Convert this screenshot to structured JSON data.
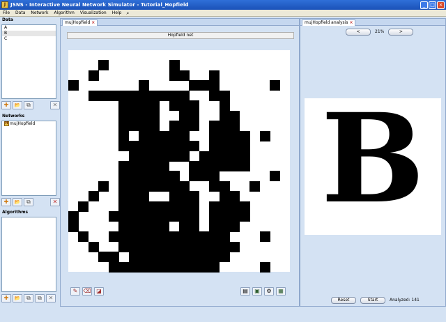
{
  "window": {
    "title": "JSNS - Interactive Neural Network Simulator - Tutorial_Hopfield",
    "icon_text": "J"
  },
  "menu": {
    "items": [
      "File",
      "Data",
      "Network",
      "Algorithm",
      "Visualization",
      "Help"
    ]
  },
  "data_section": {
    "header": "Data",
    "items": [
      "A",
      "B",
      "C"
    ],
    "selected_index": 1
  },
  "networks_section": {
    "header": "Networks",
    "items": [
      "mujHopfield"
    ],
    "badge": "H"
  },
  "algorithms_section": {
    "header": "Algorithms",
    "items": []
  },
  "net_panel": {
    "tab_label": "mujHopfield",
    "canvas_title": "Hopfield net",
    "grid_cols": 22,
    "grid_rows": 22,
    "pattern": [
      "......................",
      "...X......X...........",
      "..X.......XX..X.......",
      "X......X....XXX.....X.",
      "..XXXXXXXXXX..XX......",
      ".....XXXX.XXX..X......",
      ".....XXXX..XX..XX.....",
      ".....XXXX.XXX.XXX.....",
      ".....X.XXXXX..XXXX.X..",
      ".....XXXXXXXX.XXXX....",
      "......XXXXXX.XXXXX....",
      ".....XXXXX..XXXXXX....",
      ".....XXXXXX.XXX.....X.",
      "...X.XXXXXXX..XX..X...",
      "..X..XXX..XXX..XX.....",
      ".X...XXXXXXXX.XXXX....",
      "X...XXXXXXXXX.XXXX....",
      "X....XXXXX.XX.XXX.....",
      ".X..XXXXXXXXXXXX...X..",
      "..X..XXXXXXXXXXXX.....",
      "...XX.XXXXXXXXXX......",
      "....XXXXXXXXXXX....X.."
    ]
  },
  "analysis_panel": {
    "tab_label": "mujHopfield analysis",
    "prev_label": "<",
    "next_label": ">",
    "zoom": "21%",
    "letter": "B",
    "reset_label": "Reset",
    "start_label": "Start",
    "status": "Analyzed: 141"
  },
  "icons": {
    "close": "×",
    "minimize": "_",
    "maximize": "□",
    "tab_close": "×",
    "search": "⌕",
    "new": "✚",
    "open": "📂",
    "copy": "⧉",
    "delete": "✕"
  },
  "colors": {
    "titlebar": "#1b52b8",
    "background": "#d4e2f3",
    "delete": "#c03030"
  }
}
